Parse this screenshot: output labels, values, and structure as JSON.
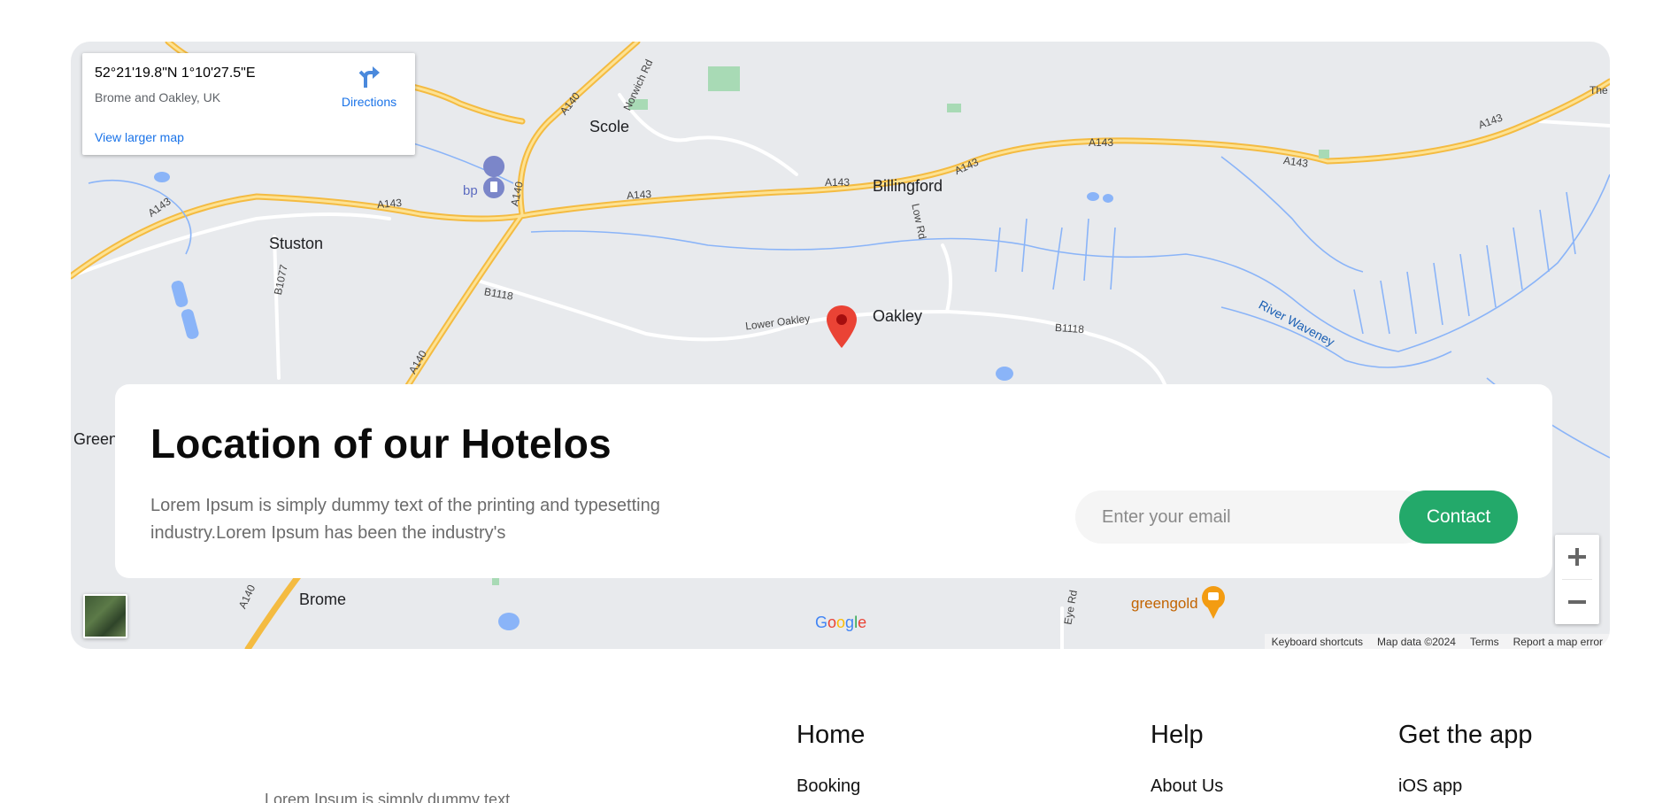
{
  "map": {
    "info_card": {
      "coords": "52°21'19.8\"N 1°10'27.5\"E",
      "address": "Brome and Oakley, UK",
      "directions_label": "Directions",
      "larger_map_label": "View larger map"
    },
    "labels": {
      "scole": "Scole",
      "billingford": "Billingford",
      "stuston": "Stuston",
      "oakley": "Oakley",
      "brome": "Brome",
      "green": "Green",
      "river": "River Waveney",
      "greengold": "greengold",
      "bp": "bp",
      "the": "The",
      "a143_1": "A143",
      "a143_2": "A143",
      "a143_3": "A143",
      "a143_4": "A143",
      "a143_5": "A143",
      "a143_6": "A143",
      "a143_7": "A143",
      "a143_8": "A143",
      "a140_1": "A140",
      "a140_2": "A140",
      "a140_3": "A140",
      "a140_4": "A140",
      "b1118_1": "B1118",
      "b1118_2": "B1118",
      "b1077": "B1077",
      "low_rd": "Low Rd",
      "eye_rd": "Eye Rd",
      "lower_oakley": "Lower Oakley",
      "norwich_rd": "Norwich Rd"
    },
    "zoom_in": "+",
    "zoom_out": "−",
    "google": "Google",
    "attribution": {
      "shortcuts": "Keyboard shortcuts",
      "map_data": "Map data ©2024",
      "terms": "Terms",
      "report": "Report a map error"
    }
  },
  "contact": {
    "title": "Location of our Hotelos",
    "description": "Lorem Ipsum is simply dummy text of the printing and typesetting industry.Lorem Ipsum has been the industry's",
    "email_placeholder": "Enter your email",
    "button_label": "Contact"
  },
  "footer": {
    "about_text": "Lorem Ipsum is simply dummy text",
    "columns": [
      {
        "heading": "Home",
        "links": [
          "Booking"
        ]
      },
      {
        "heading": "Help",
        "links": [
          "About Us"
        ]
      },
      {
        "heading": "Get the app",
        "links": [
          "iOS app"
        ]
      }
    ]
  },
  "colors": {
    "accent": "#23a96a",
    "link": "#1a73e8",
    "road_major": "#f9c74f",
    "water": "#8ab4f8",
    "pin": "#ea4335"
  }
}
